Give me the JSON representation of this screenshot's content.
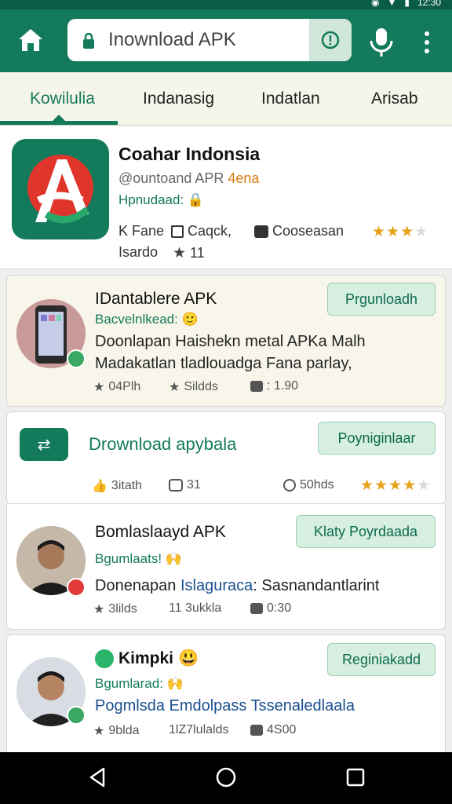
{
  "status_bar": {
    "time": "12:30"
  },
  "top_bar": {
    "search_text": "Inownload APK"
  },
  "tabs": [
    {
      "label": "Kowilulia",
      "active": true
    },
    {
      "label": "Indanasig",
      "active": false
    },
    {
      "label": "Indatlan",
      "active": false
    },
    {
      "label": "Arisab",
      "active": false
    }
  ],
  "hero": {
    "title": "Coahar Indonsia",
    "subtitle": "@ountoand APR",
    "subtitle_highlight": "4ena",
    "status": "Hpnudaad:",
    "meta1": "K Fane",
    "meta2": "Caqck,",
    "meta3": "Cooseasan",
    "meta4": "Isardo",
    "meta5": "11",
    "rating": 3
  },
  "cards": [
    {
      "title": "IDantablere APK",
      "subtitle": "Bacvelnlkead:",
      "description_line1": "Doonlapan Haishekn metal APKa Malh",
      "description_line2": "Madakatlan tladlouadga Fana parlay,",
      "button": "Prgunloadh",
      "meta1": "04Plh",
      "meta2": "Sildds",
      "meta3": ": 1.90"
    },
    {
      "title": "Drownload apybala",
      "button": "Poyniginlaar",
      "meta1": "3itath",
      "meta2": "31",
      "meta3": "50hds",
      "rating": 4
    },
    {
      "title": "Bomlaslaayd APK",
      "subtitle": "Bgumlaats!",
      "description_prefix": "Donenapan ",
      "description_link": "Islaguraca",
      "description_suffix": ": Sasnandantlarint",
      "button": "Klaty Poyrdaada",
      "meta1": "3lilds",
      "meta2": "11 3ukkla",
      "meta3": "0:30"
    },
    {
      "title": "Kimpki",
      "subtitle": "Bgumlarad:",
      "description": "Pogmlsda Emdolpass Tssenaledlaala",
      "button": "Reginiakadd",
      "meta1": "9blda",
      "meta2": "1lZ7lulalds",
      "meta3": "4S00"
    }
  ]
}
